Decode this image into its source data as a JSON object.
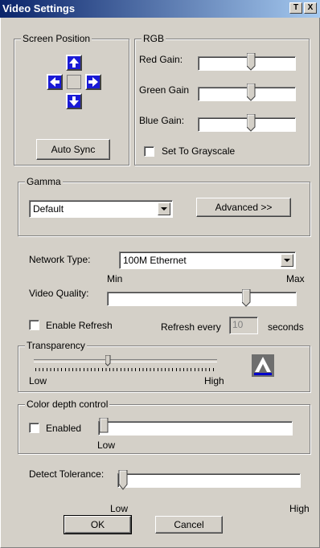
{
  "window": {
    "title": "Video Settings",
    "help_button": "T",
    "close_button": "X"
  },
  "screen_position": {
    "legend": "Screen Position",
    "auto_sync_label": "Auto Sync"
  },
  "rgb": {
    "legend": "RGB",
    "red_label": "Red Gain:",
    "green_label": "Green Gain",
    "blue_label": "Blue Gain:",
    "red_value": 0.55,
    "green_value": 0.55,
    "blue_value": 0.55,
    "grayscale_label": "Set To Grayscale",
    "grayscale_checked": false
  },
  "gamma": {
    "legend": "Gamma",
    "selected": "Default",
    "advanced_label": "Advanced >>"
  },
  "network": {
    "label": "Network Type:",
    "selected": "100M Ethernet"
  },
  "video_quality": {
    "label": "Video Quality:",
    "min_label": "Min",
    "max_label": "Max",
    "value": 0.75
  },
  "refresh": {
    "enable_label": "Enable Refresh",
    "enabled": false,
    "every_label": "Refresh every",
    "value": "10",
    "unit_label": "seconds"
  },
  "transparency": {
    "legend": "Transparency",
    "low_label": "Low",
    "high_label": "High",
    "value": 0.4,
    "logo_text": "ALTUSEN"
  },
  "color_depth": {
    "legend": "Color depth control",
    "enabled_label": "Enabled",
    "enabled": false,
    "low_label": "Low",
    "value": 0.0
  },
  "detect_tolerance": {
    "label": "Detect Tolerance:",
    "low_label": "Low",
    "high_label": "High",
    "value": 0.0
  },
  "buttons": {
    "ok_label": "OK",
    "cancel_label": "Cancel"
  },
  "colors": {
    "titlebar_start": "#0a246a",
    "titlebar_end": "#a6caf0",
    "face": "#d4d0c8",
    "arrow_blue": "#1a1ad6"
  }
}
